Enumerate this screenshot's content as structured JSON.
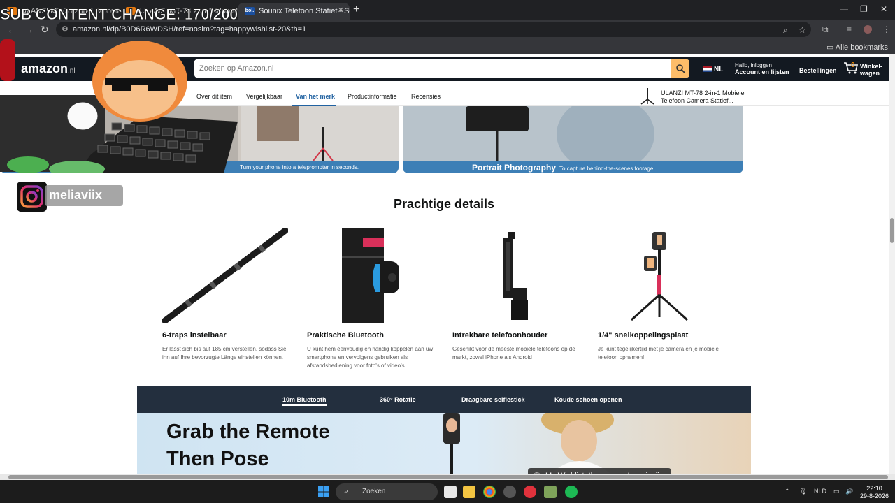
{
  "overlay": {
    "sub_counter": "SUB CONTENT CHANGE: 170/200",
    "instagram_handle": "meliaviix",
    "throne_banner": "My Wishlist: throne.com/ameliavii"
  },
  "browser": {
    "tabs": [
      {
        "label": "ULANZI MT-78 2-in-1 Mobiele T",
        "active": false
      },
      {
        "label": "ULANZI MT-78 2-in-1 Mobiele T",
        "active": false
      },
      {
        "label": "Sounix Telefoon Statief - Selfie",
        "active": true
      }
    ],
    "tab_favicon_text": "bol.",
    "url": "amazon.nl/dp/B0D6R6WDSH/ref=nosim?tag=happywishlist-20&th=1",
    "bookmarks_all": "Alle bookmarks"
  },
  "amazon": {
    "logo": "amazon",
    "logo_suffix": ".nl",
    "search_placeholder": "Zoeken op Amazon.nl",
    "lang": "NL",
    "account_line1": "Hallo, inloggen",
    "account_line2": "Account en lijsten",
    "orders": "Bestellingen",
    "cart_count": "0",
    "cart_label": "Winkel-wagen"
  },
  "subnav": {
    "items": [
      "Over dit item",
      "Vergelijkbaar",
      "Van het merk",
      "Productinformatie",
      "Recensies"
    ],
    "active": "Van het merk",
    "product_title": "ULANZI MT-78 2-in-1 Mobiele Telefoon Camera Statief..."
  },
  "banners": {
    "left_caption": "Turn your phone into a teleprompter in seconds.",
    "right_caption_title": "Portrait Photography",
    "right_caption_sub": "To capture behind-the-scenes footage."
  },
  "details": {
    "title": "Prachtige details",
    "features": [
      {
        "title": "6-traps instelbaar",
        "desc": "Er lässt sich bis auf 185 cm verstellen, sodass Sie ihn auf Ihre bevorzugte Länge einstellen können."
      },
      {
        "title": "Praktische Bluetooth",
        "desc": "U kunt hem eenvoudig en handig koppelen aan uw smartphone en vervolgens gebruiken als afstandsbediening voor foto's of video's."
      },
      {
        "title": "Intrekbare telefoonhouder",
        "desc": "Geschikt voor de meeste mobiele telefoons op de markt, zowel iPhone als Android"
      },
      {
        "title": "1/4\" snelkoppelingsplaat",
        "desc": "Je kunt tegelijkertijd met je camera en je mobiele telefoon opnemen!"
      }
    ]
  },
  "promo": {
    "tabs": [
      "10m Bluetooth",
      "360° Rotatie",
      "Draagbare selfiestick",
      "Koude schoen openen"
    ],
    "active_tab": "10m Bluetooth",
    "headline_line1": "Grab the Remote",
    "headline_line2": "Then Pose"
  },
  "taskbar": {
    "search": "Zoeken",
    "lang": "NLD",
    "time": "22:10",
    "date": "29-8-2026"
  },
  "colors": {
    "amazon_dark": "#131921",
    "amazon_orange": "#febd69",
    "link_blue": "#2162a1",
    "promo_dark": "#232f3e"
  }
}
